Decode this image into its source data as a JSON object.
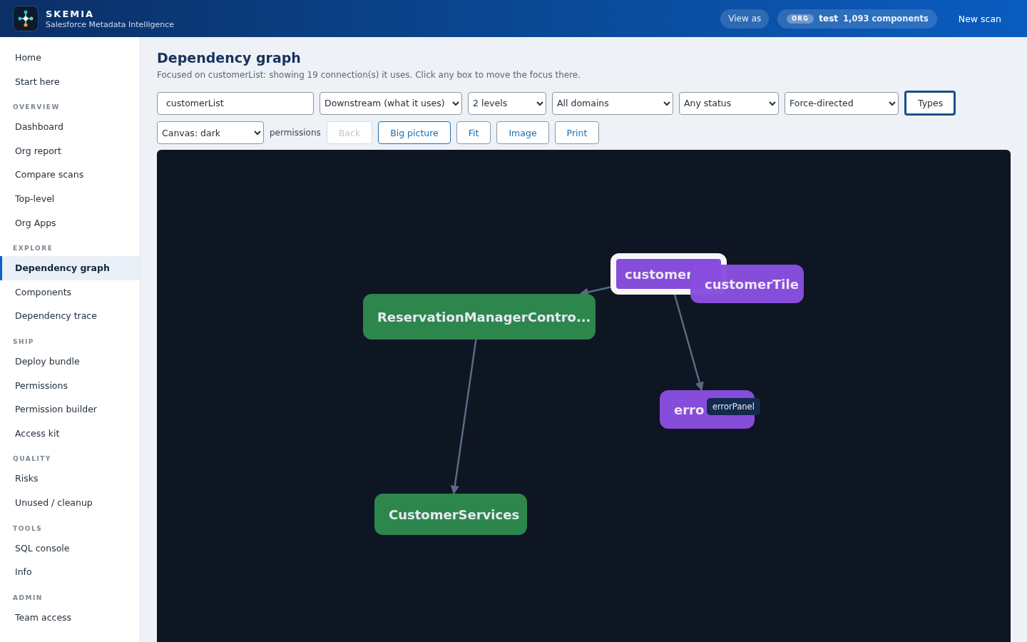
{
  "header": {
    "brand": "SKEMIA",
    "tagline": "Salesforce Metadata Intelligence",
    "view_as": "View as",
    "org": {
      "badge": "ORG",
      "name": "test",
      "count": "1,093 components"
    },
    "new_scan": "New scan"
  },
  "sidebar": {
    "items": [
      {
        "label": "Home",
        "selected": false
      },
      {
        "label": "Start here",
        "selected": false
      }
    ],
    "sections": [
      {
        "title": "OVERVIEW",
        "items": [
          {
            "label": "Dashboard",
            "selected": false
          },
          {
            "label": "Org report",
            "selected": false
          },
          {
            "label": "Compare scans",
            "selected": false
          },
          {
            "label": "Top-level",
            "selected": false
          },
          {
            "label": "Org Apps",
            "selected": false
          }
        ]
      },
      {
        "title": "EXPLORE",
        "items": [
          {
            "label": "Dependency graph",
            "selected": true
          },
          {
            "label": "Components",
            "selected": false
          },
          {
            "label": "Dependency trace",
            "selected": false
          }
        ]
      },
      {
        "title": "SHIP",
        "items": [
          {
            "label": "Deploy bundle",
            "selected": false
          },
          {
            "label": "Permissions",
            "selected": false
          },
          {
            "label": "Permission builder",
            "selected": false
          },
          {
            "label": "Access kit",
            "selected": false
          }
        ]
      },
      {
        "title": "QUALITY",
        "items": [
          {
            "label": "Risks",
            "selected": false
          },
          {
            "label": "Unused / cleanup",
            "selected": false
          }
        ]
      },
      {
        "title": "TOOLS",
        "items": [
          {
            "label": "SQL console",
            "selected": false
          },
          {
            "label": "Info",
            "selected": false
          }
        ]
      },
      {
        "title": "ADMIN",
        "items": [
          {
            "label": "Team access",
            "selected": false
          }
        ]
      }
    ]
  },
  "page": {
    "title": "Dependency graph",
    "subtitle": "Focused on customerList: showing 19 connection(s) it uses. Click any box to move the focus there."
  },
  "toolbar": {
    "search": {
      "value": "customerList"
    },
    "selects": [
      {
        "value": "Downstream (what it uses)"
      },
      {
        "value": "2 levels"
      },
      {
        "value": "All domains"
      },
      {
        "value": "Any status"
      },
      {
        "value": "Force-directed"
      }
    ],
    "types_button": {
      "label": "Types",
      "focused": true
    },
    "canvas_select": {
      "value": "Canvas: dark"
    },
    "label": "permissions",
    "buttons": [
      {
        "label": "Back",
        "kind": "disabled"
      },
      {
        "label": "Big picture",
        "kind": "active"
      },
      {
        "label": "Fit",
        "kind": "plain"
      },
      {
        "label": "Image",
        "kind": "plain"
      },
      {
        "label": "Print",
        "kind": "plain"
      }
    ]
  },
  "graph": {
    "nodes": [
      {
        "label": "customer",
        "color": "#8a4ee0",
        "focused": true
      },
      {
        "label": "customerTile",
        "color": "#8a4ee0",
        "focused": false
      },
      {
        "label": "ReservationManagerContro...",
        "color": "#2e8b4e",
        "focused": false
      },
      {
        "label": "erro",
        "color": "#8a4ee0",
        "focused": false,
        "tooltip": "errorPanel"
      },
      {
        "label": "CustomerServices",
        "color": "#2e8b4e",
        "focused": false
      }
    ]
  }
}
